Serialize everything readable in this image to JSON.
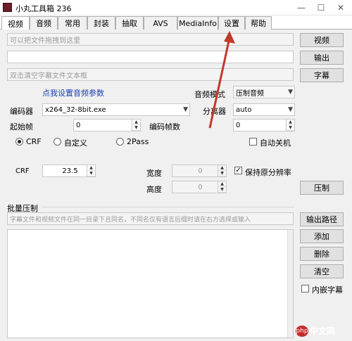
{
  "window": {
    "title": "小丸工具箱 236"
  },
  "tabs": [
    {
      "label": "视频"
    },
    {
      "label": "音频"
    },
    {
      "label": "常用"
    },
    {
      "label": "封装"
    },
    {
      "label": "抽取"
    },
    {
      "label": "AVS"
    },
    {
      "label": "MediaInfo"
    },
    {
      "label": "设置"
    },
    {
      "label": "帮助"
    }
  ],
  "video": {
    "video_input_placeholder": "可以把文件拖拽到这里",
    "video_button": "视频",
    "output_button": "输出",
    "subtitle_placeholder": "双击清空字幕文件文本框",
    "subtitle_button": "字幕",
    "audio_settings_link": "点我设置音频参数",
    "audio_mode_label": "音频模式",
    "audio_mode_value": "压制音频",
    "encoder_label": "编码器",
    "encoder_value": "x264_32-8bit.exe",
    "demuxer_label": "分离器",
    "demuxer_value": "auto",
    "start_frame_label": "起始帧",
    "start_frame_value": "0",
    "encode_frames_label": "编码帧数",
    "encode_frames_value": "0",
    "mode_crf": "CRF",
    "mode_custom": "自定义",
    "mode_2pass": "2Pass",
    "auto_shutdown": "自动关机",
    "crf_label": "CRF",
    "crf_value": "23.5",
    "width_label": "宽度",
    "width_value": "0",
    "height_label": "高度",
    "height_value": "0",
    "keep_ratio": "保持原分辨率",
    "encode_button": "压制"
  },
  "batch": {
    "title": "批量压制",
    "hint": "字幕文件和视频文件在同一目录下且同名，不同名仅有语言后缀时请在右方选择或输入",
    "output_path_button": "输出路径",
    "add_button": "添加",
    "delete_button": "删除",
    "clear_button": "清空",
    "embedded_subtitle": "内嵌字幕"
  },
  "watermark": {
    "text": "中文网",
    "badge": "php"
  },
  "colors": {
    "arrow": "#c0392b",
    "link": "#1a3fae"
  }
}
